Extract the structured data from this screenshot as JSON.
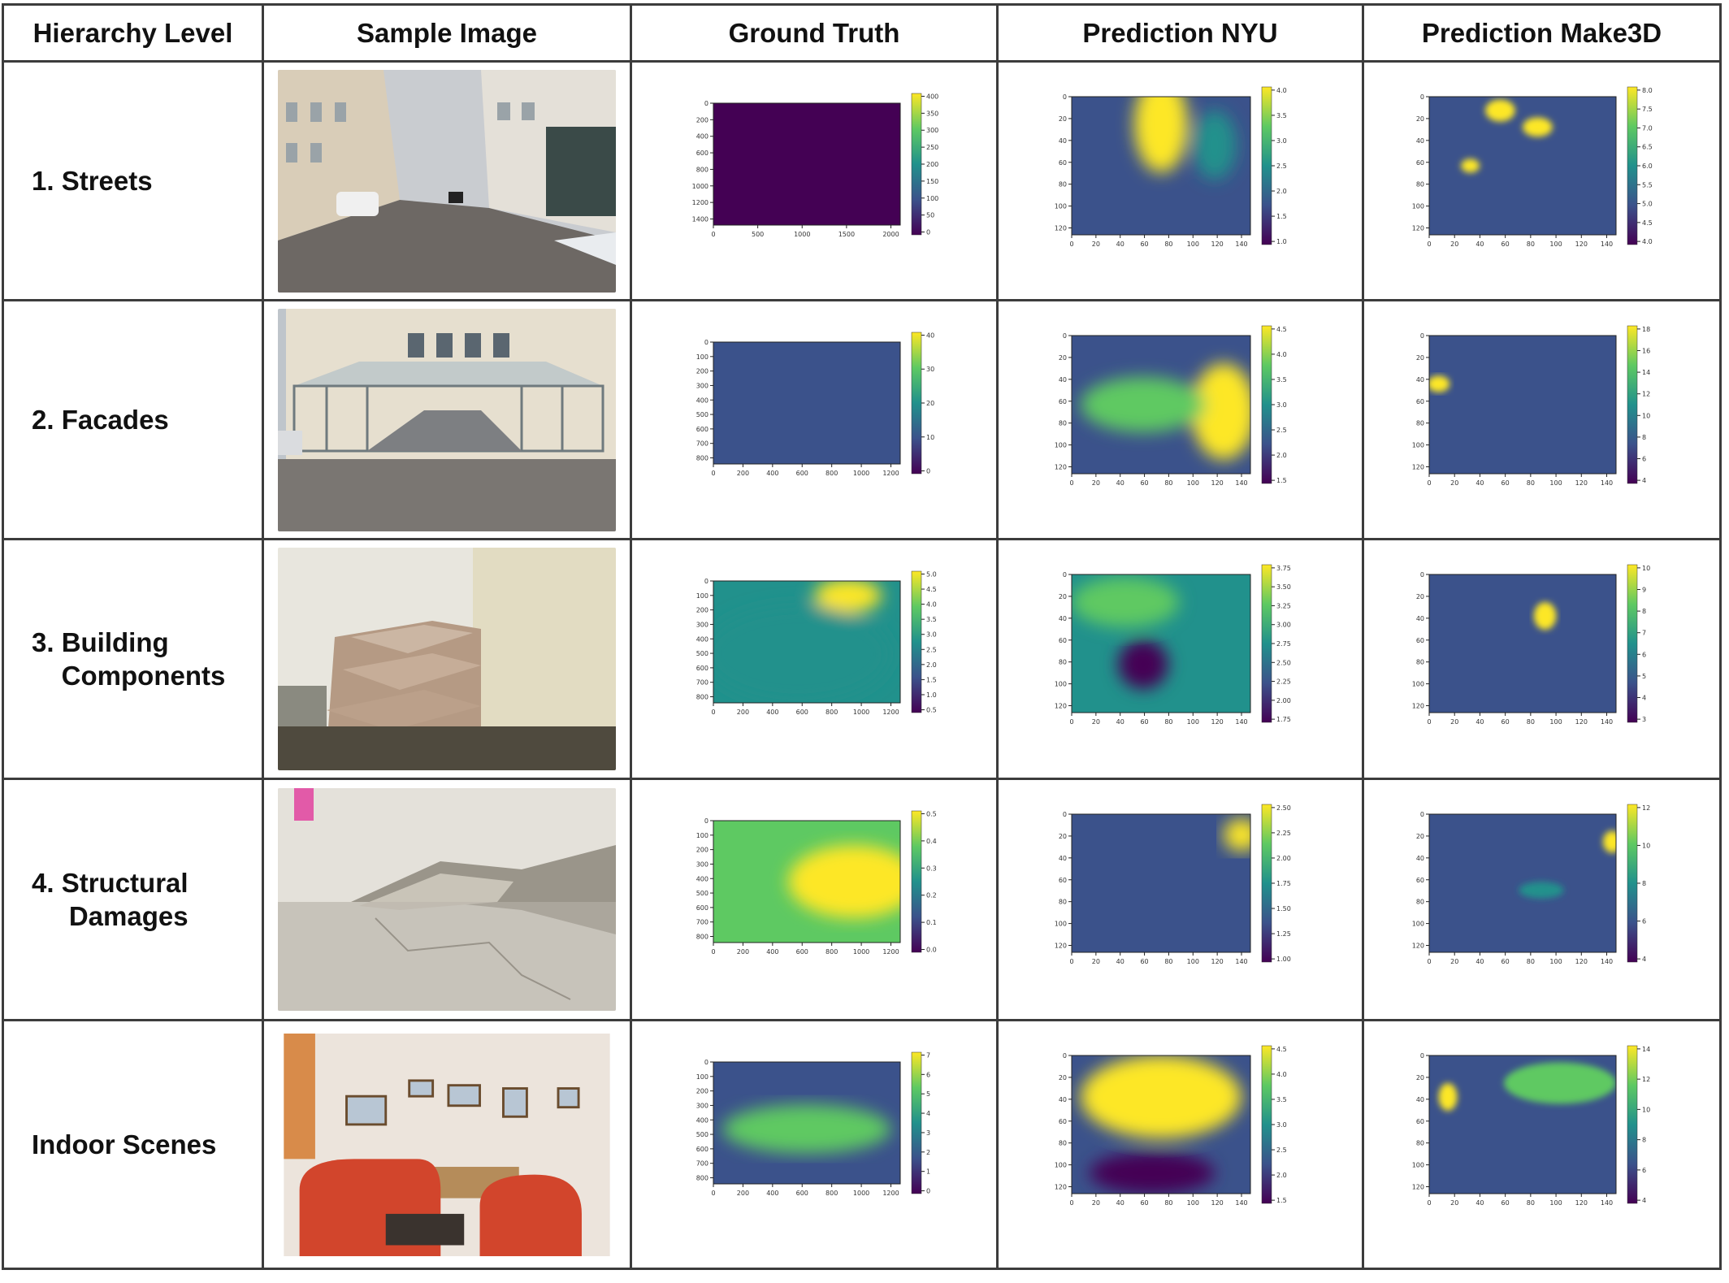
{
  "headers": [
    "Hierarchy Level",
    "Sample Image",
    "Ground Truth",
    "Prediction NYU",
    "Prediction Make3D"
  ],
  "colormap": {
    "name": "viridis",
    "stops": [
      "#440154",
      "#3b528b",
      "#21918c",
      "#5ec962",
      "#fde725"
    ]
  },
  "rows": [
    {
      "label": "1. Streets",
      "photo": "street-photo",
      "gt": {
        "xticks": [
          "0",
          "500",
          "1000",
          "1500",
          "2000"
        ],
        "yticks": [
          "0",
          "200",
          "400",
          "600",
          "800",
          "1000",
          "1200",
          "1400"
        ],
        "cbar": [
          "0",
          "50",
          "100",
          "150",
          "200",
          "250",
          "300",
          "350",
          "400"
        ]
      },
      "nyu": {
        "xticks": [
          "0",
          "20",
          "40",
          "60",
          "80",
          "100",
          "120",
          "140"
        ],
        "yticks": [
          "0",
          "20",
          "40",
          "60",
          "80",
          "100",
          "120"
        ],
        "cbar": [
          "1.0",
          "1.5",
          "2.0",
          "2.5",
          "3.0",
          "3.5",
          "4.0"
        ]
      },
      "make3d": {
        "xticks": [
          "0",
          "20",
          "40",
          "60",
          "80",
          "100",
          "120",
          "140"
        ],
        "yticks": [
          "0",
          "20",
          "40",
          "60",
          "80",
          "100",
          "120"
        ],
        "cbar": [
          "4.0",
          "4.5",
          "5.0",
          "5.5",
          "6.0",
          "6.5",
          "7.0",
          "7.5",
          "8.0"
        ]
      }
    },
    {
      "label": "2. Facades",
      "photo": "facade-photo",
      "gt": {
        "xticks": [
          "0",
          "200",
          "400",
          "600",
          "800",
          "1000",
          "1200"
        ],
        "yticks": [
          "0",
          "100",
          "200",
          "300",
          "400",
          "500",
          "600",
          "700",
          "800"
        ],
        "cbar": [
          "0",
          "10",
          "20",
          "30",
          "40"
        ]
      },
      "nyu": {
        "xticks": [
          "0",
          "20",
          "40",
          "60",
          "80",
          "100",
          "120",
          "140"
        ],
        "yticks": [
          "0",
          "20",
          "40",
          "60",
          "80",
          "100",
          "120"
        ],
        "cbar": [
          "1.5",
          "2.0",
          "2.5",
          "3.0",
          "3.5",
          "4.0",
          "4.5"
        ]
      },
      "make3d": {
        "xticks": [
          "0",
          "20",
          "40",
          "60",
          "80",
          "100",
          "120",
          "140"
        ],
        "yticks": [
          "0",
          "20",
          "40",
          "60",
          "80",
          "100",
          "120"
        ],
        "cbar": [
          "4",
          "6",
          "8",
          "10",
          "12",
          "14",
          "16",
          "18"
        ]
      }
    },
    {
      "label": "3. Building\n    Components",
      "photo": "stairs-photo",
      "gt": {
        "xticks": [
          "0",
          "200",
          "400",
          "600",
          "800",
          "1000",
          "1200"
        ],
        "yticks": [
          "0",
          "100",
          "200",
          "300",
          "400",
          "500",
          "600",
          "700",
          "800"
        ],
        "cbar": [
          "0.5",
          "1.0",
          "1.5",
          "2.0",
          "2.5",
          "3.0",
          "3.5",
          "4.0",
          "4.5",
          "5.0"
        ]
      },
      "nyu": {
        "xticks": [
          "0",
          "20",
          "40",
          "60",
          "80",
          "100",
          "120",
          "140"
        ],
        "yticks": [
          "0",
          "20",
          "40",
          "60",
          "80",
          "100",
          "120"
        ],
        "cbar": [
          "1.75",
          "2.00",
          "2.25",
          "2.50",
          "2.75",
          "3.00",
          "3.25",
          "3.50",
          "3.75"
        ]
      },
      "make3d": {
        "xticks": [
          "0",
          "20",
          "40",
          "60",
          "80",
          "100",
          "120",
          "140"
        ],
        "yticks": [
          "0",
          "20",
          "40",
          "60",
          "80",
          "100",
          "120"
        ],
        "cbar": [
          "3",
          "4",
          "5",
          "6",
          "7",
          "8",
          "9",
          "10"
        ]
      }
    },
    {
      "label": "4. Structural\n     Damages",
      "photo": "crack-photo",
      "gt": {
        "xticks": [
          "0",
          "200",
          "400",
          "600",
          "800",
          "1000",
          "1200"
        ],
        "yticks": [
          "0",
          "100",
          "200",
          "300",
          "400",
          "500",
          "600",
          "700",
          "800"
        ],
        "cbar": [
          "0.0",
          "0.1",
          "0.2",
          "0.3",
          "0.4",
          "0.5"
        ]
      },
      "nyu": {
        "xticks": [
          "0",
          "20",
          "40",
          "60",
          "80",
          "100",
          "120",
          "140"
        ],
        "yticks": [
          "0",
          "20",
          "40",
          "60",
          "80",
          "100",
          "120"
        ],
        "cbar": [
          "1.00",
          "1.25",
          "1.50",
          "1.75",
          "2.00",
          "2.25",
          "2.50"
        ]
      },
      "make3d": {
        "xticks": [
          "0",
          "20",
          "40",
          "60",
          "80",
          "100",
          "120",
          "140"
        ],
        "yticks": [
          "0",
          "20",
          "40",
          "60",
          "80",
          "100",
          "120"
        ],
        "cbar": [
          "4",
          "6",
          "8",
          "10",
          "12"
        ]
      }
    },
    {
      "label": "Indoor Scenes",
      "photo": "indoor-photo",
      "gt": {
        "xticks": [
          "0",
          "200",
          "400",
          "600",
          "800",
          "1000",
          "1200"
        ],
        "yticks": [
          "0",
          "100",
          "200",
          "300",
          "400",
          "500",
          "600",
          "700",
          "800"
        ],
        "cbar": [
          "0",
          "1",
          "2",
          "3",
          "4",
          "5",
          "6",
          "7"
        ]
      },
      "nyu": {
        "xticks": [
          "0",
          "20",
          "40",
          "60",
          "80",
          "100",
          "120",
          "140"
        ],
        "yticks": [
          "0",
          "20",
          "40",
          "60",
          "80",
          "100",
          "120"
        ],
        "cbar": [
          "1.5",
          "2.0",
          "2.5",
          "3.0",
          "3.5",
          "4.0",
          "4.5"
        ]
      },
      "make3d": {
        "xticks": [
          "0",
          "20",
          "40",
          "60",
          "80",
          "100",
          "120",
          "140"
        ],
        "yticks": [
          "0",
          "20",
          "40",
          "60",
          "80",
          "100",
          "120"
        ],
        "cbar": [
          "4",
          "6",
          "8",
          "10",
          "12",
          "14"
        ]
      }
    }
  ]
}
